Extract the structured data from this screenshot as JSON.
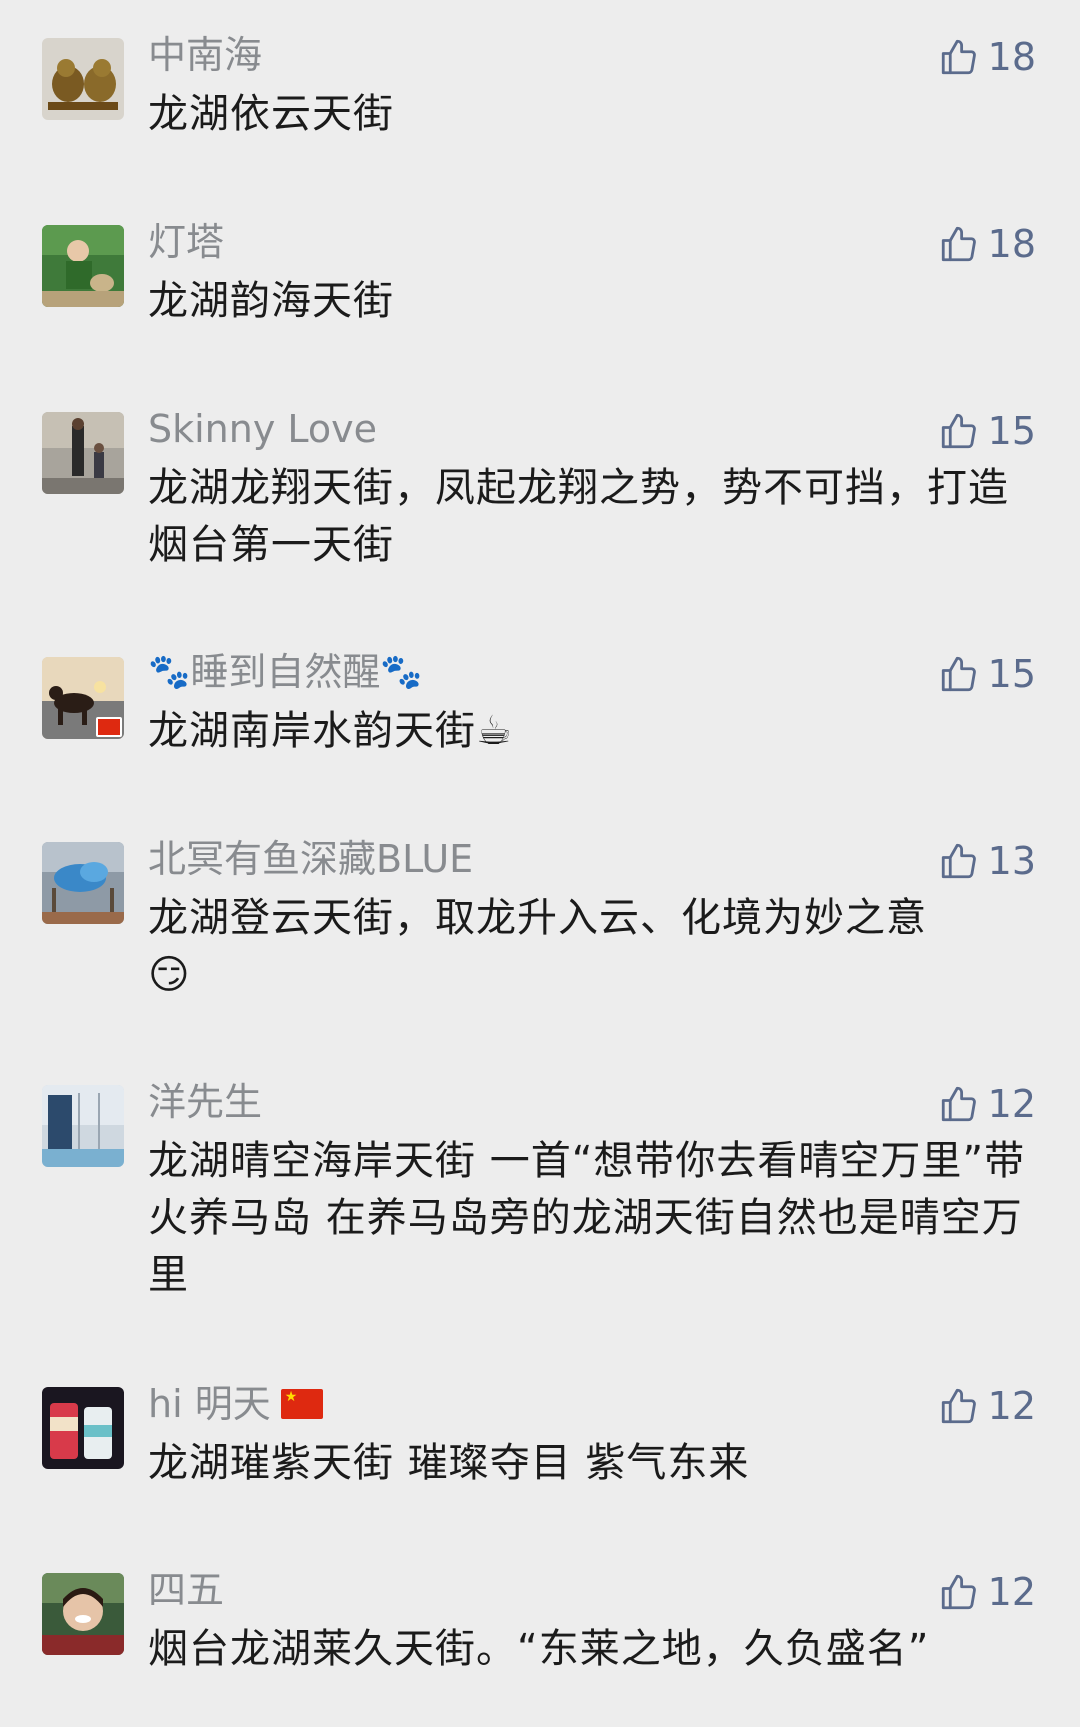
{
  "comments": [
    {
      "name": "中南海",
      "text": "龙湖依云天街",
      "likes": "18"
    },
    {
      "name": "灯塔",
      "text": "龙湖韵海天街",
      "likes": "18"
    },
    {
      "name": "Skinny Love",
      "text": "龙湖龙翔天街，凤起龙翔之势，势不可挡，打造烟台第一天街",
      "likes": "15"
    },
    {
      "name": "睡到自然醒",
      "name_decor": "🐾",
      "text": "龙湖南岸水韵天街",
      "text_emoji": "☕",
      "likes": "15"
    },
    {
      "name": "北冥有鱼深藏BLUE",
      "text": "龙湖登云天街，取龙升入云、化境为妙之意",
      "text_emoji": "😏",
      "likes": "13"
    },
    {
      "name": "洋先生",
      "text": "龙湖晴空海岸天街 一首“想带你去看晴空万里”带火养马岛 在养马岛旁的龙湖天街自然也是晴空万里",
      "likes": "12"
    },
    {
      "name": "hi 明天",
      "text": "龙湖璀紫天街 璀璨夺目 紫气东来",
      "likes": "12"
    },
    {
      "name": "四五",
      "text": "烟台龙湖莱久天街。“东莱之地，久负盛名”",
      "likes": "12"
    }
  ],
  "colors": {
    "background": "#ededed",
    "name": "#888b8f",
    "text": "#1b1b1b",
    "like": "#5b6b8c"
  },
  "icons": {
    "like": "thumbs-up-icon",
    "flag": "china-flag-icon"
  }
}
